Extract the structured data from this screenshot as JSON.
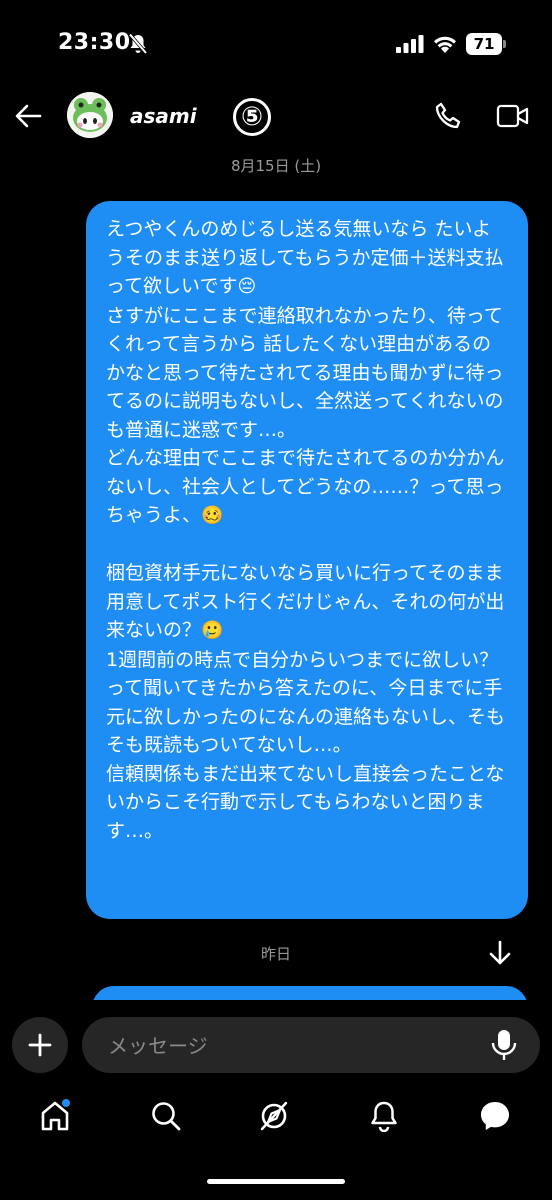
{
  "status_bar": {
    "time": "23:30",
    "battery": "71",
    "icons": [
      "bell-slash-icon",
      "signal-icon",
      "wifi-icon",
      "battery-icon"
    ]
  },
  "header": {
    "username": "asami",
    "badge": "⑤",
    "icons": [
      "back-arrow-icon",
      "phone-icon",
      "video-call-icon"
    ]
  },
  "thread": {
    "date_separator_1": "8月15日 (土)",
    "message": {
      "paragraph_1": "えつやくんのめじるし送る気無いなら たいようそのまま送り返してもらうか定価＋送料支払って欲しいです",
      "paragraph_1_emoji": "😔",
      "paragraph_2": "さすがにここまで連絡取れなかったり、待ってくれって言うから 話したくない理由があるのかなと思って待たされてる理由も聞かずに待ってるのに説明もないし、全然送ってくれないのも普通に迷惑です…。",
      "paragraph_3": "どんな理由でここまで待たされてるのか分かんないし、社会人としてどうなの……？って思っちゃうよ、",
      "paragraph_3_emoji": "🥴",
      "paragraph_4": "梱包資材手元にないなら買いに行ってそのまま用意してポスト行くだけじゃん、それの何が出来ないの？",
      "paragraph_4_emoji": "🥲",
      "paragraph_5": "1週間前の時点で自分からいつまでに欲しい？って聞いてきたから答えたのに、今日までに手元に欲しかったのになんの連絡もないし、そもそも既読もついてないし…。",
      "paragraph_6": "信頼関係もまだ出来てないし直接会ったことないからこそ行動で示してもらわないと困ります…。"
    },
    "date_separator_2": "昨日"
  },
  "composer": {
    "placeholder": "メッセージ"
  },
  "colors": {
    "background": "#000000",
    "bubble": "#1e8ef5",
    "input": "#262626",
    "muted_text": "#9a9a9a"
  },
  "bottom_nav": [
    "home-icon",
    "search-icon",
    "explore-icon",
    "notifications-icon",
    "messages-icon"
  ]
}
